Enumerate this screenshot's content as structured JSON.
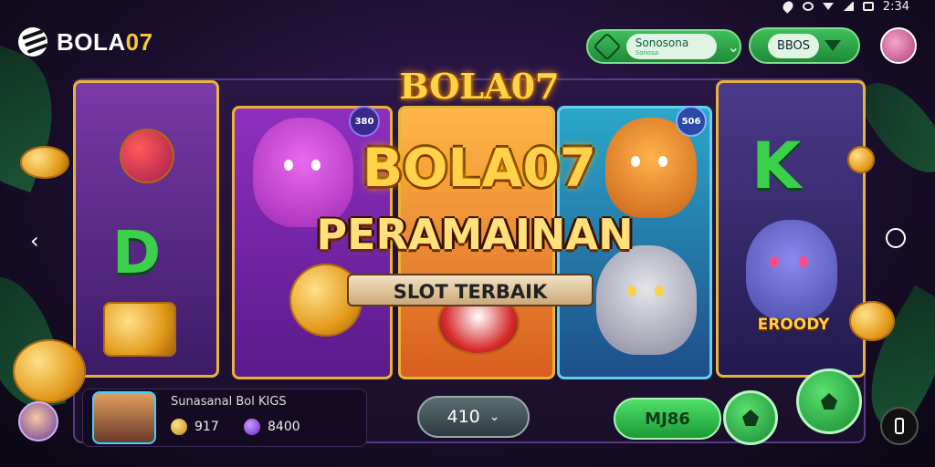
{
  "status_bar": {
    "time": "2:34"
  },
  "brand": {
    "name_prefix": "BOLA",
    "name_suffix": "07"
  },
  "top": {
    "select_label": "Sonosona",
    "select_sub": "Sonosa",
    "button_label": "BBOS"
  },
  "banner": {
    "crown_title": "BOLA07",
    "main_title": "BOLA07",
    "sub_title": "PERAMAINAN",
    "tagline": "SLOT TERBAIK",
    "emblem": "EROODY",
    "badge_left": "380",
    "badge_right": "506"
  },
  "player": {
    "name": "Sunasanal Bol KIGS",
    "coins": "917",
    "gems": "8400"
  },
  "controls": {
    "bet_value": "410",
    "spin_label": "MJ86"
  },
  "colors": {
    "gold": "#ffd24a",
    "green": "#2fb14a",
    "purple": "#2b1745"
  }
}
